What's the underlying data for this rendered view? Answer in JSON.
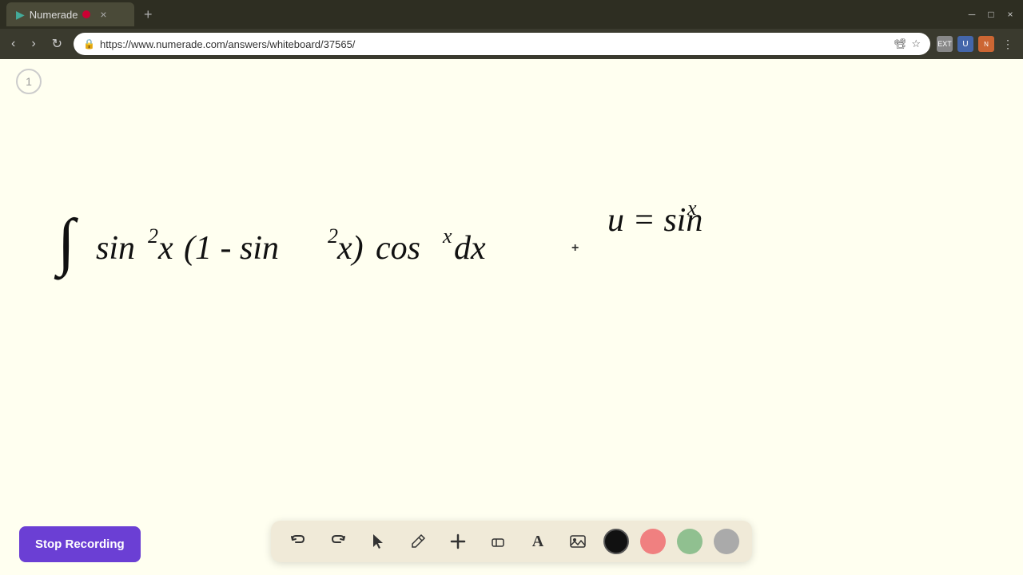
{
  "browser": {
    "tab": {
      "favicon": "▶",
      "title": "Numerade",
      "close": "×",
      "new_tab": "+"
    },
    "window_controls": {
      "minimize": "─",
      "maximize": "□",
      "close": "×"
    },
    "nav": {
      "back": "‹",
      "forward": "›",
      "refresh": "↻",
      "url": "https://www.numerade.com/answers/whiteboard/37565/",
      "bookmark": "☆",
      "menu": "⋮"
    }
  },
  "page": {
    "number": "1",
    "background_color": "#fffff0"
  },
  "toolbar": {
    "undo_label": "↩",
    "redo_label": "↪",
    "select_label": "▶",
    "pencil_label": "✏",
    "add_label": "+",
    "eraser_label": "⌫",
    "text_label": "A",
    "image_label": "🖼",
    "colors": [
      {
        "name": "black",
        "hex": "#111111",
        "active": true
      },
      {
        "name": "pink",
        "hex": "#f08080"
      },
      {
        "name": "green",
        "hex": "#90c090"
      },
      {
        "name": "gray",
        "hex": "#aaaaaa"
      }
    ]
  },
  "stop_recording": {
    "label": "Stop Recording"
  }
}
